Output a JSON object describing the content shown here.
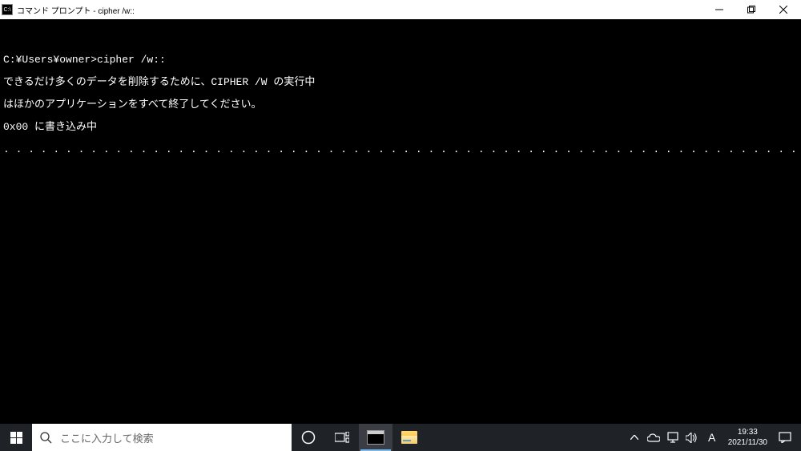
{
  "titlebar": {
    "icon_label": "C:\\",
    "title": "コマンド プロンプト - cipher  /w::"
  },
  "terminal": {
    "blank_line": " ",
    "prompt_line": "C:¥Users¥owner>cipher /w::",
    "line1": "できるだけ多くのデータを削除するために、CIPHER /W の実行中",
    "line2": "はほかのアプリケーションをすべて終了してください。",
    "line3": "0x00 に書き込み中",
    "dots": ". . . . . . . . . . . . . . . . . . . . . . . . . . . . . . . . . . . . . . . . . . . . . . . . . . . . . . . . . . . . . . . . . . . . . . . . . . . . . . . . . . . . . . . . . . . . . . . . . . . . . . "
  },
  "taskbar": {
    "search_placeholder": "ここに入力して検索",
    "ime_mode": "A",
    "time": "19:33",
    "date": "2021/11/30"
  }
}
